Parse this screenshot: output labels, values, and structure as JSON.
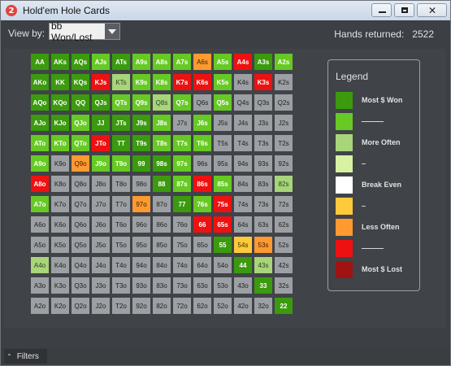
{
  "window": {
    "title": "Hold'em Hole Cards",
    "app_icon_text": "2"
  },
  "toolbar": {
    "viewby_label": "View by:",
    "viewby_value": "bb Won/Lost",
    "hands_label": "Hands returned:",
    "hands_value": "2522"
  },
  "colors": {
    "win": "#3b9a0e",
    "green": "#67c924",
    "lgreen": "#a8d47a",
    "pale": "#d6f2a2",
    "neutral": "#9c9fa3",
    "white": "#ffffff",
    "yellow": "#ffca3a",
    "orange": "#ff9a30",
    "red": "#ee1111",
    "dred": "#a01313"
  },
  "grid": {
    "rows": [
      [
        "AA",
        "AKs",
        "AQs",
        "AJs",
        "ATs",
        "A9s",
        "A8s",
        "A7s",
        "A6s",
        "A5s",
        "A4s",
        "A3s",
        "A2s"
      ],
      [
        "AKo",
        "KK",
        "KQs",
        "KJs",
        "KTs",
        "K9s",
        "K8s",
        "K7s",
        "K6s",
        "K5s",
        "K4s",
        "K3s",
        "K2s"
      ],
      [
        "AQo",
        "KQo",
        "QQ",
        "QJs",
        "QTs",
        "Q9s",
        "Q8s",
        "Q7s",
        "Q6s",
        "Q5s",
        "Q4s",
        "Q3s",
        "Q2s"
      ],
      [
        "AJo",
        "KJo",
        "QJo",
        "JJ",
        "JTs",
        "J9s",
        "J8s",
        "J7s",
        "J6s",
        "J5s",
        "J4s",
        "J3s",
        "J2s"
      ],
      [
        "ATo",
        "KTo",
        "QTo",
        "JTo",
        "TT",
        "T9s",
        "T8s",
        "T7s",
        "T6s",
        "T5s",
        "T4s",
        "T3s",
        "T2s"
      ],
      [
        "A9o",
        "K9o",
        "Q9o",
        "J9o",
        "T9o",
        "99",
        "98s",
        "97s",
        "96s",
        "95s",
        "94s",
        "93s",
        "92s"
      ],
      [
        "A8o",
        "K8o",
        "Q8o",
        "J8o",
        "T8o",
        "98o",
        "88",
        "87s",
        "86s",
        "85s",
        "84s",
        "83s",
        "82s"
      ],
      [
        "A7o",
        "K7o",
        "Q7o",
        "J7o",
        "T7o",
        "97o",
        "87o",
        "77",
        "76s",
        "75s",
        "74s",
        "73s",
        "72s"
      ],
      [
        "A6o",
        "K6o",
        "Q6o",
        "J6o",
        "T6o",
        "96o",
        "86o",
        "76o",
        "66",
        "65s",
        "64s",
        "63s",
        "62s"
      ],
      [
        "A5o",
        "K5o",
        "Q5o",
        "J5o",
        "T5o",
        "95o",
        "85o",
        "75o",
        "65o",
        "55",
        "54s",
        "53s",
        "52s"
      ],
      [
        "A4o",
        "K4o",
        "Q4o",
        "J4o",
        "T4o",
        "94o",
        "84o",
        "74o",
        "64o",
        "54o",
        "44",
        "43s",
        "42s"
      ],
      [
        "A3o",
        "K3o",
        "Q3o",
        "J3o",
        "T3o",
        "93o",
        "83o",
        "73o",
        "63o",
        "53o",
        "43o",
        "33",
        "32s"
      ],
      [
        "A2o",
        "K2o",
        "Q2o",
        "J2o",
        "T2o",
        "92o",
        "82o",
        "72o",
        "62o",
        "52o",
        "42o",
        "32o",
        "22"
      ]
    ],
    "categories": [
      [
        "win",
        "win",
        "win",
        "green",
        "win",
        "green",
        "green",
        "green",
        "orange",
        "green",
        "red",
        "win",
        "green"
      ],
      [
        "win",
        "win",
        "win",
        "red",
        "lgreen",
        "green",
        "green",
        "red",
        "red",
        "green",
        "neutral",
        "red",
        "neutral"
      ],
      [
        "win",
        "win",
        "win",
        "win",
        "green",
        "green",
        "lgreen",
        "green",
        "neutral",
        "green",
        "neutral",
        "neutral",
        "neutral"
      ],
      [
        "win",
        "win",
        "green",
        "win",
        "win",
        "win",
        "green",
        "neutral",
        "green",
        "neutral",
        "neutral",
        "neutral",
        "neutral"
      ],
      [
        "green",
        "green",
        "green",
        "red",
        "win",
        "win",
        "green",
        "green",
        "green",
        "neutral",
        "neutral",
        "neutral",
        "neutral"
      ],
      [
        "green",
        "neutral",
        "orange",
        "green",
        "green",
        "win",
        "win",
        "green",
        "neutral",
        "neutral",
        "neutral",
        "neutral",
        "neutral"
      ],
      [
        "red",
        "neutral",
        "neutral",
        "neutral",
        "neutral",
        "neutral",
        "win",
        "green",
        "red",
        "green",
        "neutral",
        "neutral",
        "lgreen"
      ],
      [
        "green",
        "neutral",
        "neutral",
        "neutral",
        "neutral",
        "orange",
        "neutral",
        "win",
        "green",
        "red",
        "neutral",
        "neutral",
        "neutral"
      ],
      [
        "neutral",
        "neutral",
        "neutral",
        "neutral",
        "neutral",
        "neutral",
        "neutral",
        "neutral",
        "red",
        "red",
        "neutral",
        "neutral",
        "neutral"
      ],
      [
        "neutral",
        "neutral",
        "neutral",
        "neutral",
        "neutral",
        "neutral",
        "neutral",
        "neutral",
        "neutral",
        "win",
        "yellow",
        "orange",
        "neutral"
      ],
      [
        "lgreen",
        "neutral",
        "neutral",
        "neutral",
        "neutral",
        "neutral",
        "neutral",
        "neutral",
        "neutral",
        "neutral",
        "win",
        "lgreen",
        "neutral"
      ],
      [
        "neutral",
        "neutral",
        "neutral",
        "neutral",
        "neutral",
        "neutral",
        "neutral",
        "neutral",
        "neutral",
        "neutral",
        "neutral",
        "win",
        "neutral"
      ],
      [
        "neutral",
        "neutral",
        "neutral",
        "neutral",
        "neutral",
        "neutral",
        "neutral",
        "neutral",
        "neutral",
        "neutral",
        "neutral",
        "neutral",
        "win"
      ]
    ]
  },
  "legend": {
    "title": "Legend",
    "items": [
      {
        "label": "Most $ Won",
        "color": "#3b9a0e"
      },
      {
        "label": "———",
        "color": "#67c924"
      },
      {
        "label": "More Often",
        "color": "#a8d47a"
      },
      {
        "label": "–",
        "color": "#d6f2a2"
      },
      {
        "label": "Break Even",
        "color": "#ffffff"
      },
      {
        "label": "–",
        "color": "#ffca3a"
      },
      {
        "label": "Less Often",
        "color": "#ff9a30"
      },
      {
        "label": "———",
        "color": "#ee1111"
      },
      {
        "label": "Most $ Lost",
        "color": "#a01313"
      }
    ]
  },
  "status": {
    "filters_label": "Filters"
  }
}
